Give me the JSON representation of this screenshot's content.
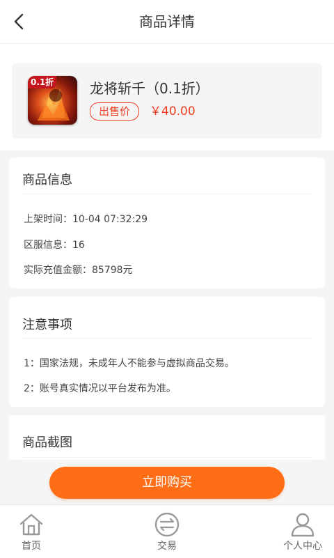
{
  "header": {
    "title": "商品详情"
  },
  "product": {
    "badge": "0.1折",
    "name": "龙将斩千（0.1折）",
    "price_label": "出售价",
    "price": "￥40.00"
  },
  "info": {
    "title": "商品信息",
    "rows": [
      "上架时间：10-04 07:32:29",
      "区服信息：16",
      "实际充值金额：85798元"
    ]
  },
  "notice": {
    "title": "注意事项",
    "rows": [
      "1：国家法规，未成年人不能参与虚拟商品交易。",
      "2：账号真实情况以平台发布为准。"
    ]
  },
  "screenshots": {
    "title": "商品截图"
  },
  "buy_button": {
    "label": "立即购买"
  },
  "tabbar": {
    "items": [
      {
        "label": "首页",
        "icon": "home-icon"
      },
      {
        "label": "交易",
        "icon": "trade-icon"
      },
      {
        "label": "个人中心",
        "icon": "user-icon"
      }
    ]
  },
  "colors": {
    "accent": "#ff6d16",
    "price": "#f03c1e",
    "icon_gray": "#999999"
  }
}
